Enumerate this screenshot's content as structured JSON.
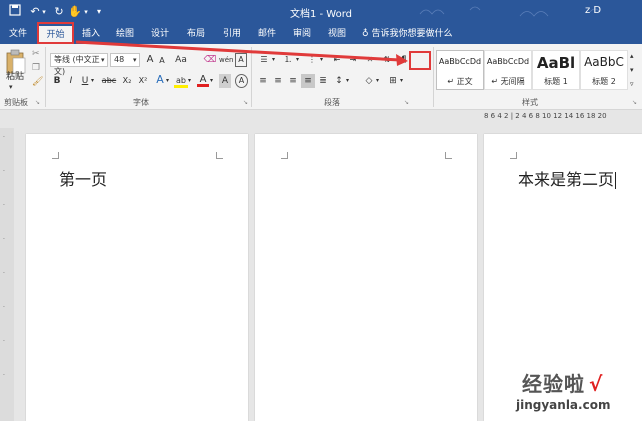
{
  "title_bar": {
    "title": "文档1 - Word",
    "user": "z D",
    "quick_access": {
      "save_icon": "save-icon",
      "undo_icon": "undo-icon",
      "redo_icon": "redo-icon",
      "touch_icon": "touch-mode-icon",
      "customize_icon": "customize-qat-icon"
    }
  },
  "tabs": [
    {
      "label": "文件"
    },
    {
      "label": "开始",
      "active": true
    },
    {
      "label": "插入"
    },
    {
      "label": "绘图"
    },
    {
      "label": "设计"
    },
    {
      "label": "布局"
    },
    {
      "label": "引用"
    },
    {
      "label": "邮件"
    },
    {
      "label": "审阅"
    },
    {
      "label": "视图"
    }
  ],
  "tell_me": "告诉我你想要做什么",
  "ribbon": {
    "clipboard": {
      "paste_label": "粘贴",
      "group_label": "剪贴板"
    },
    "font": {
      "font_name": "等线 (中文正文)",
      "font_size": "48",
      "grow_label": "A",
      "shrink_label": "A",
      "case_label": "Aa",
      "phonetic_label": "wén",
      "bold_label": "B",
      "italic_label": "I",
      "underline_label": "U",
      "strike_label": "abc",
      "sub_label": "X₂",
      "sup_label": "X²",
      "effects_label": "A",
      "highlight_label": "ab",
      "color_label": "A",
      "shade_label": "A",
      "circle_label": "A",
      "group_label": "字体"
    },
    "paragraph": {
      "group_label": "段落"
    },
    "styles": {
      "items": [
        {
          "sample": "AaBbCcDd",
          "name": "↵ 正文"
        },
        {
          "sample": "AaBbCcDd",
          "name": "↵ 无间隔"
        },
        {
          "sample": "AaBl",
          "name": "标题 1"
        },
        {
          "sample": "AaBbC",
          "name": "标题 2"
        }
      ],
      "group_label": "样式"
    }
  },
  "ruler": {
    "numbers": "8 6 4 2 | 2 4 6 8 10 12 14 16 18 20"
  },
  "pages": [
    {
      "text": "第一页"
    },
    {
      "text": ""
    },
    {
      "text": "本来是第二页"
    }
  ],
  "watermark": {
    "text": "经验啦",
    "check": "√",
    "url": "jingyanla.com"
  },
  "colors": {
    "accent": "#2b579a",
    "highlight_red": "#e03a3a",
    "ribbon_bg": "#f3f3f3"
  }
}
